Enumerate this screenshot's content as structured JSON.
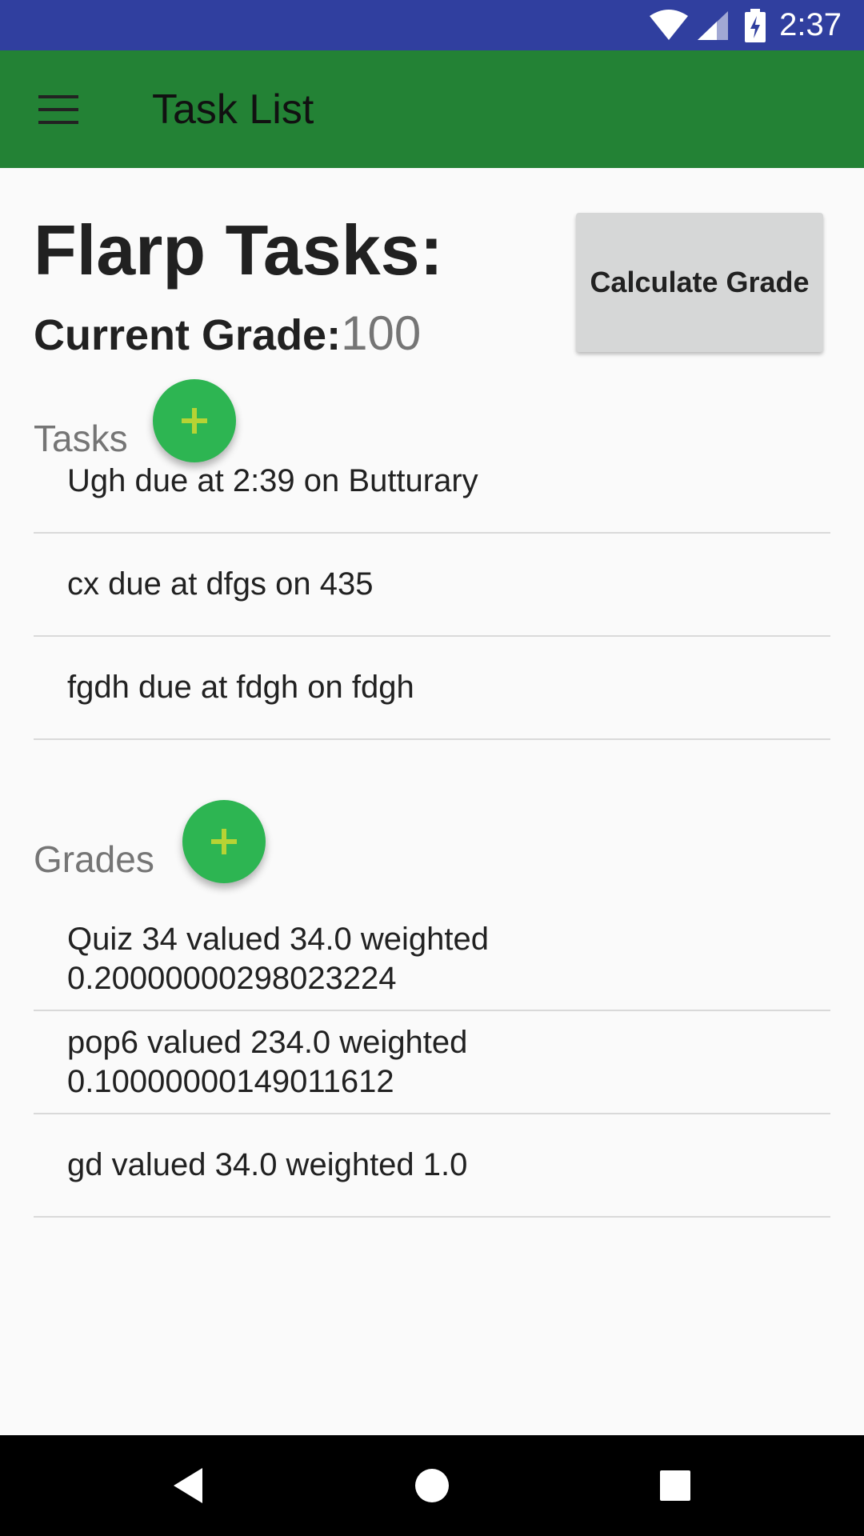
{
  "status_bar": {
    "time": "2:37",
    "background": "#303f9f"
  },
  "app_bar": {
    "title": "Task List",
    "menu_icon": "hamburger-menu-icon",
    "background": "#238235"
  },
  "header": {
    "title": "Flarp Tasks:",
    "grade_label": "Current Grade:",
    "grade_value": "100",
    "calculate_button": "Calculate Grade"
  },
  "tasks": {
    "label": "Tasks",
    "add_icon": "plus-icon",
    "items": [
      "Ugh due at 2:39 on Butturary",
      "cx due at dfgs on 435",
      "fgdh due at fdgh on fdgh"
    ]
  },
  "grades": {
    "label": "Grades",
    "add_icon": "plus-icon",
    "items": [
      "Quiz 34 valued 34.0 weighted 0.20000000298023224",
      "pop6 valued 234.0 weighted 0.10000000149011612",
      "gd valued 34.0 weighted 1.0"
    ]
  },
  "nav_bar": {
    "back_icon": "back-triangle-icon",
    "home_icon": "home-circle-icon",
    "recents_icon": "recents-square-icon"
  },
  "colors": {
    "fab": "#2db552",
    "fab_plus": "#b7d334",
    "accent_green": "#238235"
  }
}
